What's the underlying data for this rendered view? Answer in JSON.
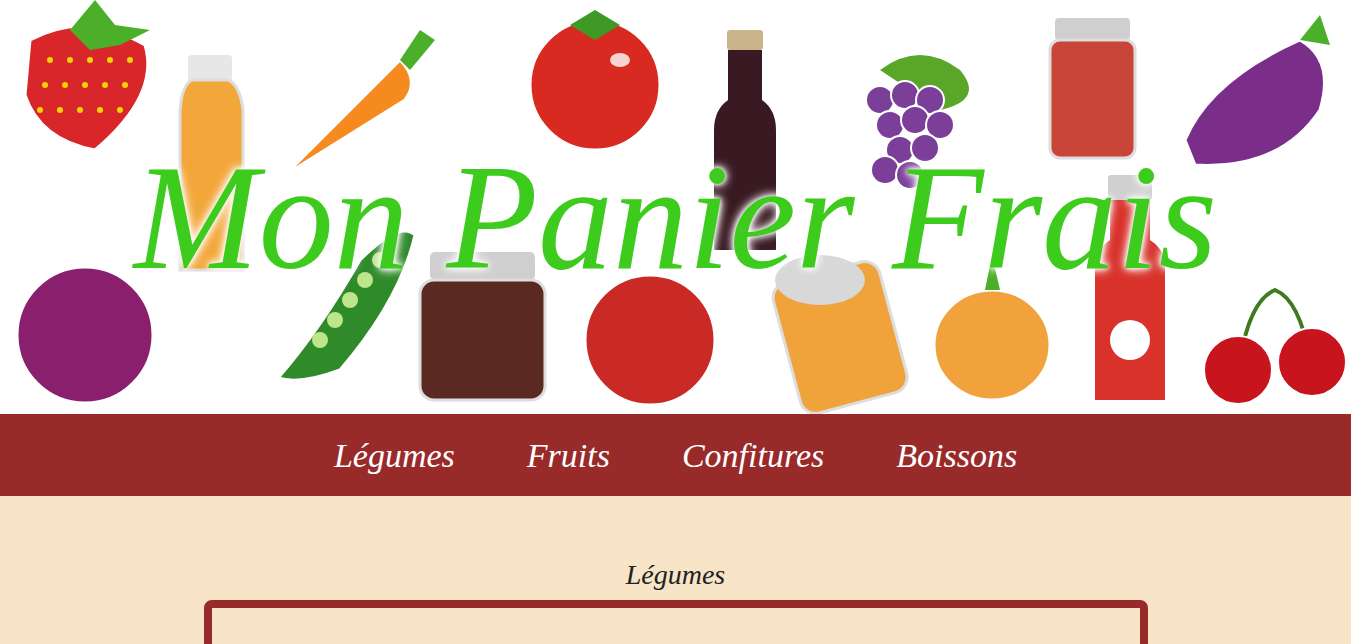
{
  "header": {
    "title": "Mon Panier Frais"
  },
  "nav": [
    {
      "label": "Légumes"
    },
    {
      "label": "Fruits"
    },
    {
      "label": "Confitures"
    },
    {
      "label": "Boissons"
    }
  ],
  "section": {
    "title": "Légumes"
  }
}
